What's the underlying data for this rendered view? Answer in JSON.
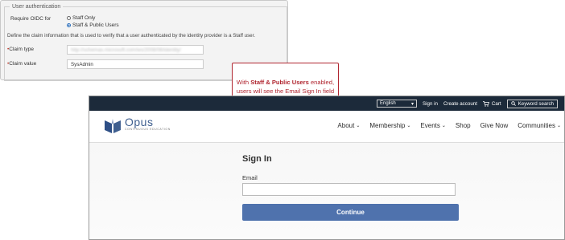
{
  "admin": {
    "legend": "User authentication",
    "require_label": "Require OIDC for",
    "radio_options": [
      {
        "label": "Staff Only",
        "checked": false
      },
      {
        "label": "Staff & Public Users",
        "checked": true
      }
    ],
    "help_text": "Define the claim information that is used to verify that a user authenticated by the identity provider is a Staff user.",
    "claim_type_label": "Claim type",
    "claim_type_value": "http://schemas.microsoft.com/ws/2008/06/identity/",
    "claim_value_label": "Claim value",
    "claim_value_value": "SysAdmin"
  },
  "callout": {
    "prefix": "With ",
    "highlight": "Staff & Public Users",
    "suffix": " enabled, users will see the Email Sign In field when logging in."
  },
  "site": {
    "topbar": {
      "language": "English",
      "signin": "Sign in",
      "create_account": "Create account",
      "cart": "Cart",
      "search": "Keyword search"
    },
    "logo_word": "Opus",
    "logo_sub": "CONTINUOUS EDUCATION",
    "nav": [
      "About",
      "Membership",
      "Events",
      "Shop",
      "Give Now",
      "Communities"
    ],
    "signin_title": "Sign In",
    "email_label": "Email",
    "continue_label": "Continue"
  },
  "colors": {
    "accent_red": "#b0252f",
    "topbar": "#1c2a3a",
    "button": "#4f72ad",
    "logo": "#3f5f8f"
  }
}
